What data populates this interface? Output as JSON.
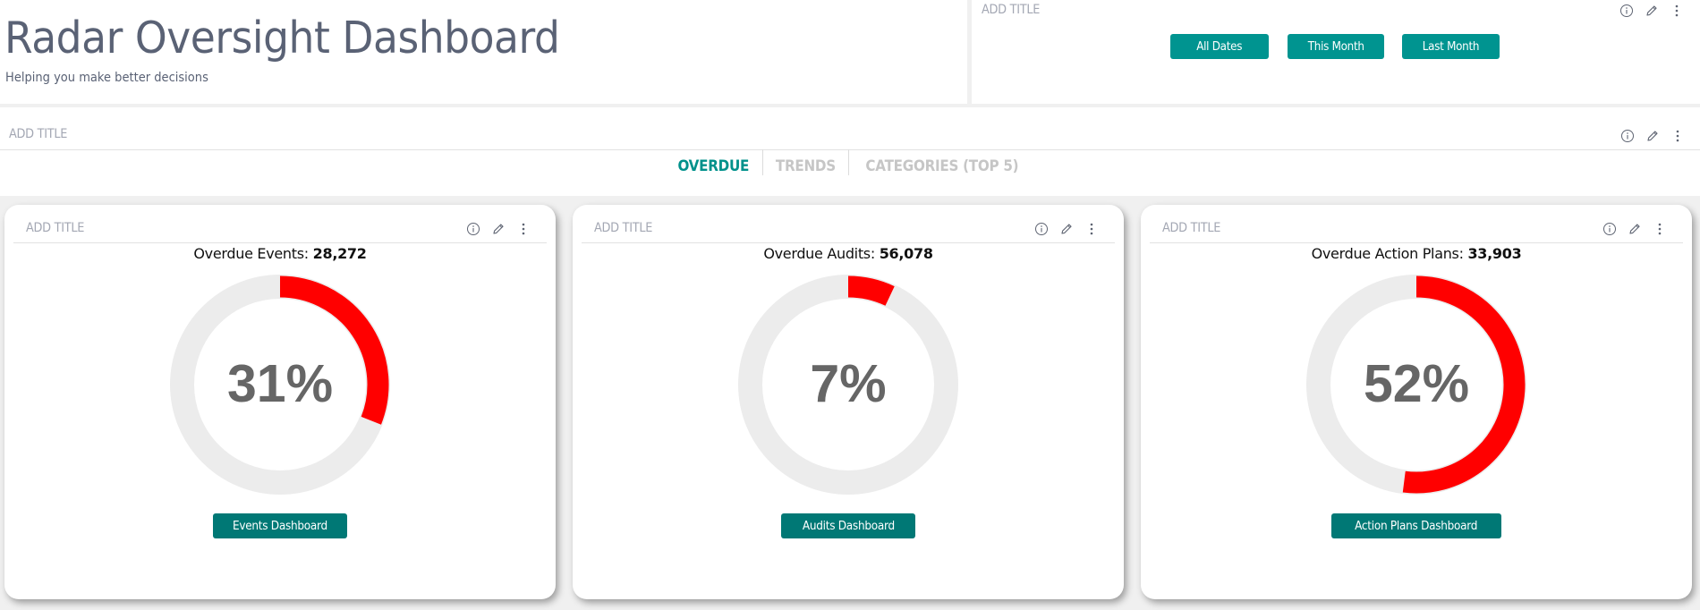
{
  "header": {
    "title": "Radar Oversight Dashboard",
    "subtitle": "Helping you make better decisions"
  },
  "date_filter": {
    "add_title": "ADD TITLE",
    "buttons": [
      "All Dates",
      "This Month",
      "Last Month"
    ]
  },
  "tabs_panel": {
    "add_title": "ADD TITLE",
    "tabs": [
      {
        "label": "OVERDUE",
        "active": true
      },
      {
        "label": "TRENDS",
        "active": false
      },
      {
        "label": "CATEGORIES (TOP 5)",
        "active": false
      }
    ]
  },
  "icons": {
    "info": "info-icon",
    "edit": "pencil-icon",
    "more": "kebab-menu-icon"
  },
  "colors": {
    "accent": "#009490",
    "button_dark": "#007875",
    "tab_active": "#00918b",
    "gauge_fill": "#ff0000",
    "gauge_track": "#ececec",
    "percent_text": "#666666",
    "title_text": "#5a6275"
  },
  "cards": [
    {
      "add_title": "ADD TITLE",
      "metric_label": "Overdue Events: ",
      "metric_value": "28,272",
      "percent": 31,
      "percent_label": "31%",
      "button": "Events Dashboard"
    },
    {
      "add_title": "ADD TITLE",
      "metric_label": "Overdue Audits: ",
      "metric_value": "56,078",
      "percent": 7,
      "percent_label": "7%",
      "button": "Audits Dashboard"
    },
    {
      "add_title": "ADD TITLE",
      "metric_label": "Overdue Action Plans: ",
      "metric_value": "33,903",
      "percent": 52,
      "percent_label": "52%",
      "button": "Action Plans Dashboard"
    }
  ]
}
